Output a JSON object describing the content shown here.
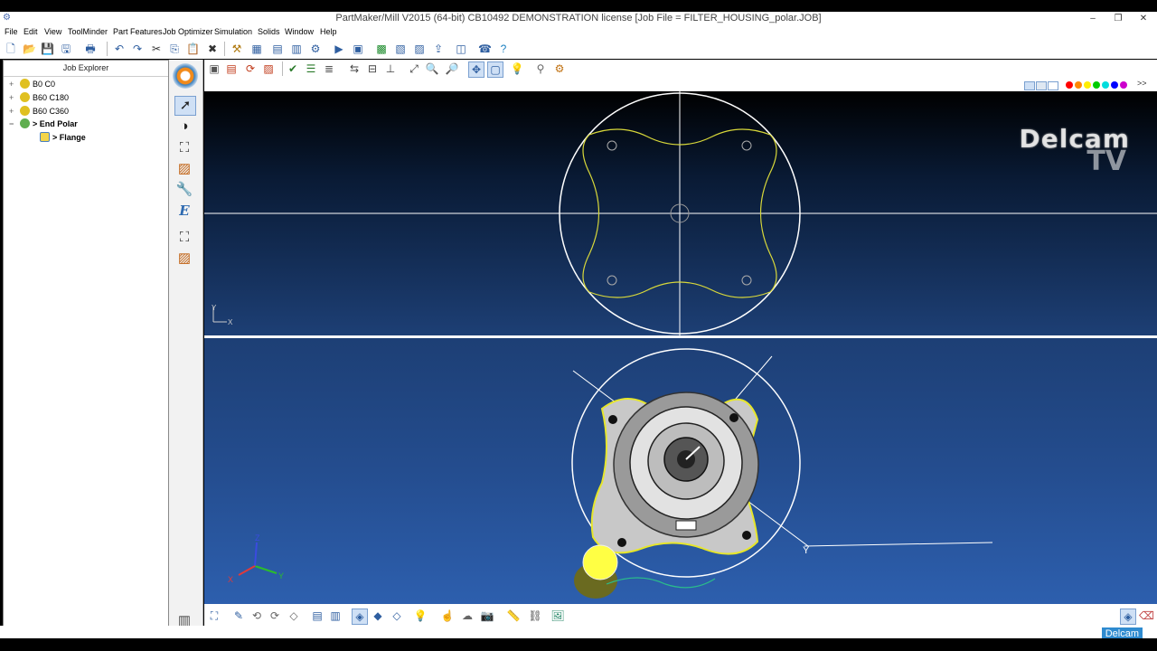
{
  "window": {
    "title": "PartMaker/Mill V2015 (64-bit) CB10492 DEMONSTRATION license   [Job File = FILTER_HOUSING_polar.JOB]",
    "minimize": "–",
    "restore": "❐",
    "close": "✕"
  },
  "menu": [
    "File",
    "Edit",
    "View",
    "ToolMinder",
    "Part Features",
    "Job Optimizer",
    "Simulation",
    "Solids",
    "Window",
    "Help"
  ],
  "explorer": {
    "title": "Job Explorer",
    "items": [
      {
        "label": "B0 C0",
        "expander": "+",
        "bold": false
      },
      {
        "label": "B60 C180",
        "expander": "+",
        "bold": false
      },
      {
        "label": "B60 C360",
        "expander": "+",
        "bold": false
      },
      {
        "label": "> End Polar",
        "expander": "−",
        "bold": true
      },
      {
        "label": "> Flange",
        "expander": "",
        "bold": true
      }
    ]
  },
  "view2d": {
    "axis_y": "Y",
    "axis_x": "X"
  },
  "view3d": {
    "axis_x": "X",
    "axis_y": "Y",
    "axis_z": "Z",
    "arrow_label": "Y"
  },
  "colors": {
    "swatches": [
      "#ff0000",
      "#ff8800",
      "#ffee00",
      "#00cc00",
      "#00dddd",
      "#0000ff",
      "#cc00cc"
    ],
    "part_outline": "#e6e62b",
    "construction": "#ffffff"
  },
  "branding": {
    "watermark_top": "Delcam",
    "watermark_bottom": "TV",
    "badge": "Delcam"
  },
  "icons": {
    "toolbar": [
      "new-file-icon",
      "open-file-icon",
      "save-icon",
      "save-as-icon",
      "print-icon",
      "undo-icon",
      "redo-icon",
      "cut-icon",
      "copy-icon",
      "paste-icon",
      "delete-icon",
      "tool-database-icon",
      "part-icon",
      "process-table-icon",
      "simulation-icon",
      "job-optimizer-icon",
      "help-icon"
    ],
    "left": [
      "select-arrow-icon",
      "stock-icon",
      "contour-icon",
      "tool-path-icon",
      "tool-icon",
      "edit-icon",
      "contour2-icon",
      "tool-path2-icon"
    ]
  }
}
